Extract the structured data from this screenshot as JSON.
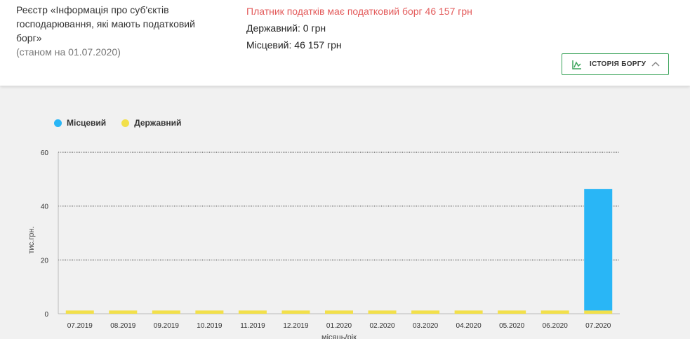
{
  "header": {
    "registry_line1": "Реєстр «Інформація про суб'єктів",
    "registry_line2": "господарювання, які мають податковий",
    "registry_line3": "борг»",
    "as_of": "(станом на 01.07.2020)"
  },
  "debt_summary": {
    "alert": "Платник податків має податковий борг 46 157 грн",
    "state": "Державний: 0 грн",
    "local": "Місцевий: 46 157 грн"
  },
  "history_button": {
    "label": "ІСТОРІЯ БОРГУ",
    "icon": "line-chart-icon",
    "chevron": "chevron-up-icon"
  },
  "colors": {
    "local": "#29b6f6",
    "state": "#f2e04a",
    "accent_green": "#3aa35a",
    "alert_red": "#e35a5a"
  },
  "chart_data": {
    "type": "bar",
    "stacked": true,
    "categories": [
      "07.2019",
      "08.2019",
      "09.2019",
      "10.2019",
      "11.2019",
      "12.2019",
      "01.2020",
      "02.2020",
      "03.2020",
      "04.2020",
      "05.2020",
      "06.2020",
      "07.2020"
    ],
    "series": [
      {
        "name": "Місцевий",
        "color": "#29b6f6",
        "values": [
          0,
          0,
          0,
          0,
          0,
          0,
          0,
          0,
          0,
          0,
          0,
          0,
          45.2
        ]
      },
      {
        "name": "Державний",
        "color": "#f2e04a",
        "values": [
          1.2,
          1.2,
          1.2,
          1.2,
          1.2,
          1.2,
          1.2,
          1.2,
          1.2,
          1.2,
          1.2,
          1.2,
          1.2
        ]
      }
    ],
    "legend_order": [
      "Місцевий",
      "Державний"
    ],
    "legend_position": "top-left",
    "yticks": [
      "0",
      "20",
      "40",
      "60"
    ],
    "ylim": [
      0,
      60
    ],
    "ylabel": "тис.грн.",
    "xlabel": "місяць/рік",
    "grid": "horizontal-dotted"
  }
}
